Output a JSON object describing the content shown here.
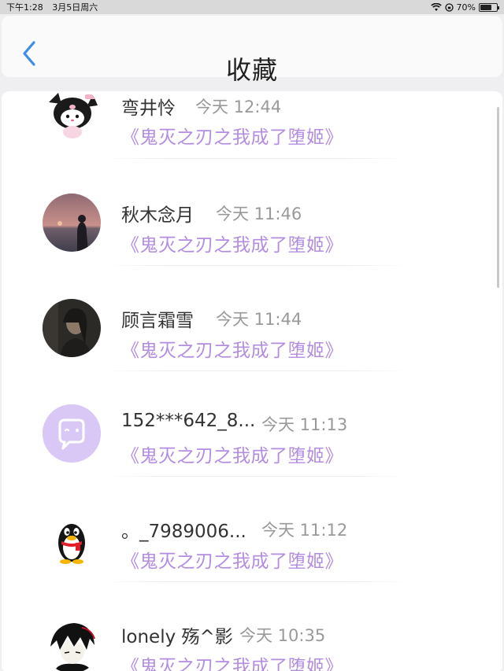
{
  "status_bar": {
    "time": "下午1:28",
    "date": "3月5日周六",
    "battery": "70%",
    "battery_level": 0.7
  },
  "header": {
    "title": "收藏",
    "back_icon": "chevron-left-icon"
  },
  "colors": {
    "accent": "#3d8ee8",
    "book_title": "#b28de0",
    "time_text": "#999999"
  },
  "items": [
    {
      "name": "弯井怜",
      "time": "今天 12:44",
      "book": "《鬼灭之刃之我成了堕姬》",
      "avatar": "kuromi-avatar"
    },
    {
      "name": "秋木念月",
      "time": "今天 11:46",
      "book": "《鬼灭之刃之我成了堕姬》",
      "avatar": "sunset-silhouette-avatar"
    },
    {
      "name": "顾言霜雪",
      "time": "今天 11:44",
      "book": "《鬼灭之刃之我成了堕姬》",
      "avatar": "portrait-avatar"
    },
    {
      "name": "152***642_8...",
      "time": "今天 11:13",
      "book": "《鬼灭之刃之我成了堕姬》",
      "avatar": "default-chat-avatar"
    },
    {
      "name": "。_7989006...",
      "time": "今天 11:12",
      "book": "《鬼灭之刃之我成了堕姬》",
      "avatar": "qq-penguin-avatar"
    },
    {
      "name": "lonely 殇^影",
      "time": "今天 10:35",
      "book": "《鬼灭之刃之我成了堕姬》",
      "avatar": "anime-character-avatar"
    }
  ]
}
